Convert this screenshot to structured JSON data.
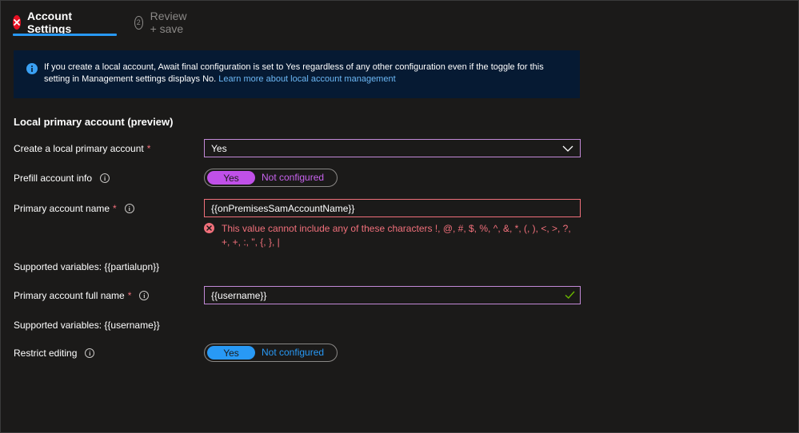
{
  "wizard": {
    "step1_label": "Account Settings",
    "step2_number": "2",
    "step2_label": "Review + save"
  },
  "banner": {
    "text": "If you create a local account, Await final configuration is set to Yes regardless of any other configuration even if the toggle for this setting in Management settings displays No. ",
    "link": "Learn more about local account management"
  },
  "section": {
    "title": "Local primary account (preview)"
  },
  "form": {
    "create_local": {
      "label": "Create a local primary account",
      "required": "*",
      "value": "Yes"
    },
    "prefill": {
      "label": "Prefill account info",
      "info": "i",
      "on_label": "Yes",
      "off_label": "Not configured"
    },
    "account_name": {
      "label": "Primary account name",
      "required": "*",
      "info": "i",
      "value": "{{onPremisesSamAccountName}}",
      "error": "This value cannot include any of these characters !, @, #, $, %, ^, &, *, (, ), <, >, ?, +, +, :, \", {, }, |",
      "supported": "Supported variables: {{partialupn}}"
    },
    "full_name": {
      "label": "Primary account full name",
      "required": "*",
      "info": "i",
      "value": "{{username}}",
      "supported": "Supported variables: {{username}}"
    },
    "restrict": {
      "label": "Restrict editing",
      "info": "i",
      "on_label": "Yes",
      "off_label": "Not configured"
    }
  },
  "colors": {
    "accent": "#2899f5",
    "error": "#f1707b",
    "toggle_purple": "#c050e8",
    "banner_bg": "#061a33"
  }
}
